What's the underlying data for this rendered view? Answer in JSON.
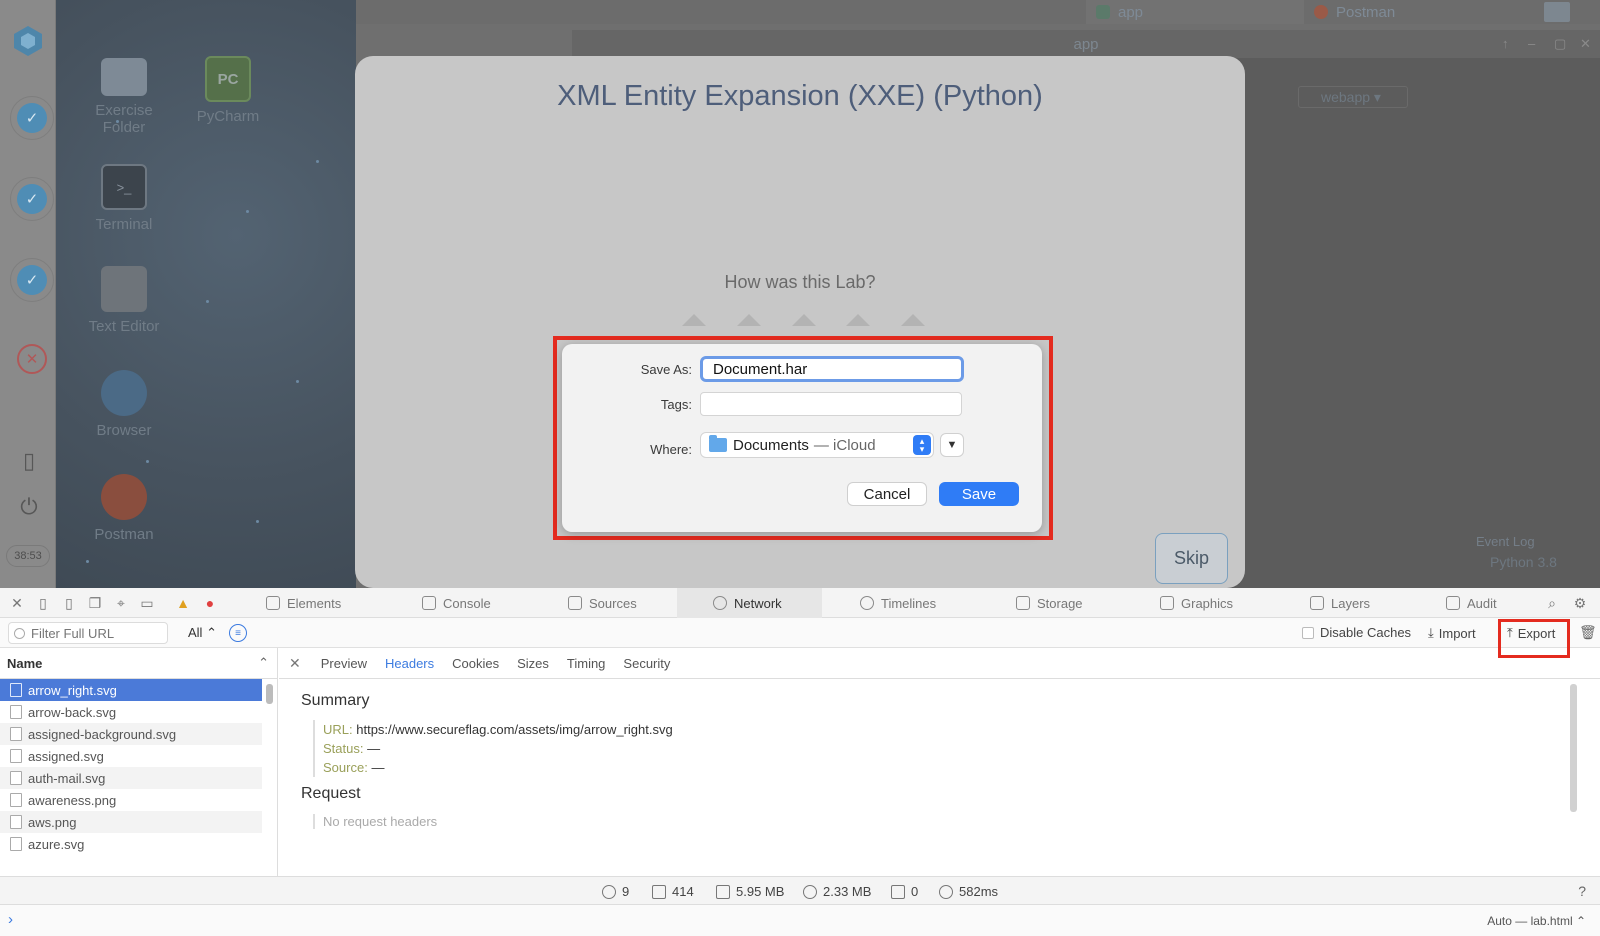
{
  "taskbar": {
    "tabs": [
      {
        "label": "app"
      },
      {
        "label": "Postman"
      }
    ]
  },
  "rail": {
    "timer": "38:53"
  },
  "desktop": {
    "icons": [
      {
        "label": "Exercise Folder"
      },
      {
        "label": "PyCharm"
      },
      {
        "label": "Terminal"
      },
      {
        "label": "Text Editor"
      },
      {
        "label": "Browser"
      },
      {
        "label": "Postman"
      }
    ]
  },
  "ide": {
    "title": "app",
    "run_config": "webapp",
    "status_event_log": "Event Log",
    "status_python": "Python 3.8"
  },
  "lab_modal": {
    "title": "XML Entity Expansion (XXE) (Python)",
    "question": "How was this Lab?",
    "skip_label": "Skip"
  },
  "save_dialog": {
    "save_as_label": "Save As:",
    "save_as_value": "Document.har",
    "tags_label": "Tags:",
    "tags_value": "",
    "where_label": "Where:",
    "where_folder": "Documents",
    "where_location": "— iCloud",
    "cancel_label": "Cancel",
    "save_label": "Save"
  },
  "devtools": {
    "tabs": [
      {
        "label": "Elements"
      },
      {
        "label": "Console"
      },
      {
        "label": "Sources"
      },
      {
        "label": "Network"
      },
      {
        "label": "Timelines"
      },
      {
        "label": "Storage"
      },
      {
        "label": "Graphics"
      },
      {
        "label": "Layers"
      },
      {
        "label": "Audit"
      }
    ],
    "filter_placeholder": "Filter Full URL",
    "type_filter": "All",
    "disable_caches_label": "Disable Caches",
    "import_label": "Import",
    "export_label": "Export",
    "list": {
      "header": "Name",
      "rows": [
        "arrow_right.svg",
        "arrow-back.svg",
        "assigned-background.svg",
        "assigned.svg",
        "auth-mail.svg",
        "awareness.png",
        "aws.png",
        "azure.svg"
      ]
    },
    "detail": {
      "tabs": [
        "Preview",
        "Headers",
        "Cookies",
        "Sizes",
        "Timing",
        "Security"
      ],
      "summary_title": "Summary",
      "url_key": "URL:",
      "url_value": "https://www.secureflag.com/assets/img/arrow_right.svg",
      "status_key": "Status:",
      "status_value": "—",
      "source_key": "Source:",
      "source_value": "—",
      "request_title": "Request",
      "no_request_headers": "No request headers"
    },
    "status": {
      "domains": "9",
      "resources": "414",
      "size": "5.95 MB",
      "transferred": "2.33 MB",
      "redirects": "0",
      "time": "582ms"
    },
    "console_context": "Auto — lab.html"
  }
}
